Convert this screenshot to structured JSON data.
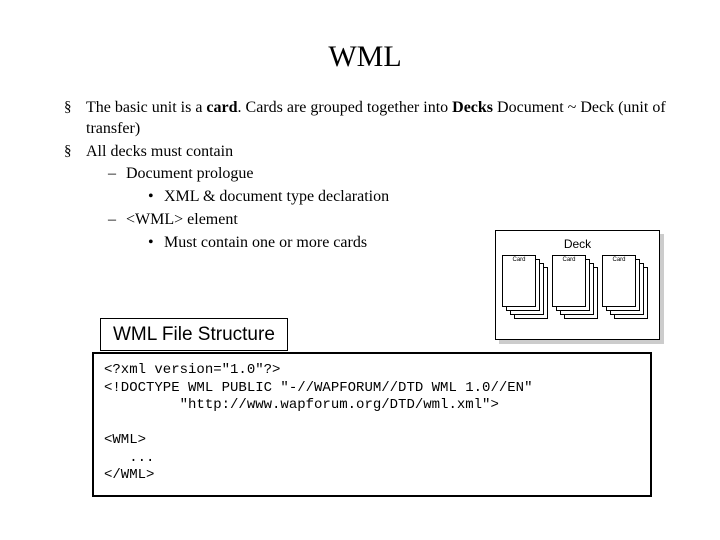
{
  "title": "WML",
  "bullets": {
    "b1_pre": "The basic unit is a ",
    "b1_bold": "card",
    "b1_post1": ". Cards are grouped together into ",
    "b1_bold2": "Decks",
    "b1_post2": " Document ~ Deck (unit of transfer)",
    "b2": "All decks must contain",
    "b2_a": "Document prologue",
    "b2_a_i": "XML & document type declaration",
    "b2_b": "<WML> element",
    "b2_b_i": "Must contain one or more cards"
  },
  "diagram": {
    "deck_label": "Deck",
    "card_label": "Card"
  },
  "file_structure_heading": "WML File Structure",
  "code": {
    "l1": "<?xml version=\"1.0\"?>",
    "l2": "<!DOCTYPE WML PUBLIC \"-//WAPFORUM//DTD WML 1.0//EN\"",
    "l3": "         \"http://www.wapforum.org/DTD/wml.xml\">",
    "blank": "",
    "l4": "<WML>",
    "l5": "   ...",
    "l6": "</WML>"
  }
}
